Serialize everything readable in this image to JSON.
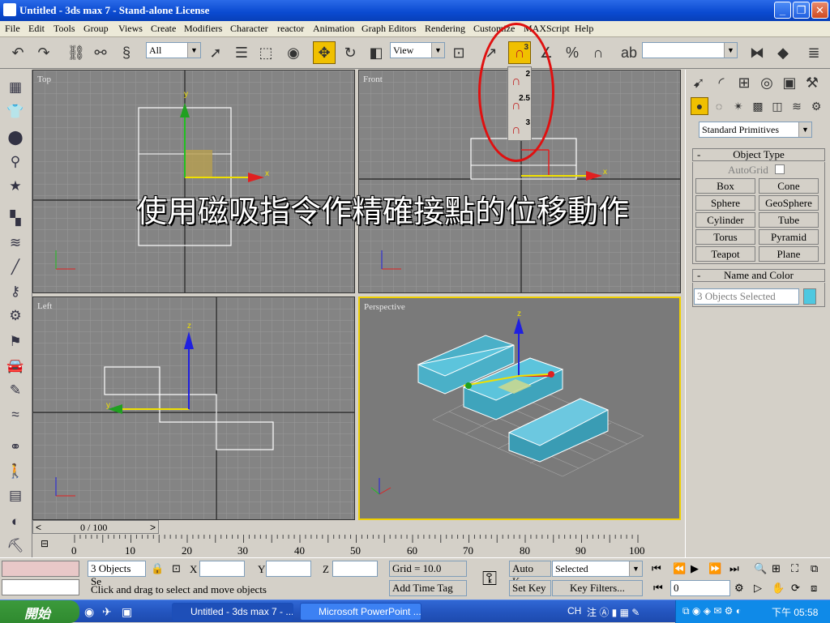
{
  "window": {
    "title": "Untitled - 3ds max 7  - Stand-alone License"
  },
  "menu": [
    "File",
    "Edit",
    "Tools",
    "Group",
    "Views",
    "Create",
    "Modifiers",
    "Character",
    "reactor",
    "Animation",
    "Graph Editors",
    "Rendering",
    "Customize",
    "MAXScript",
    "Help"
  ],
  "toolbar": {
    "selection_filter": "All",
    "ref_coord": "View",
    "named_selection": ""
  },
  "snap_flyout": {
    "items": [
      "2",
      "2.5",
      "3"
    ],
    "active": "3"
  },
  "viewports": {
    "top": "Top",
    "front": "Front",
    "left": "Left",
    "perspective": "Perspective"
  },
  "caption": "使用磁吸指令作精確接點的位移動作",
  "command_panel": {
    "category": "Standard Primitives",
    "object_type_header": "Object Type",
    "autogrid": "AutoGrid",
    "buttons": [
      "Box",
      "Cone",
      "Sphere",
      "GeoSphere",
      "Cylinder",
      "Tube",
      "Torus",
      "Pyramid",
      "Teapot",
      "Plane"
    ],
    "name_color_header": "Name and Color",
    "name_value": "3 Objects Selected",
    "swatch_color": "#4ec8e0",
    "minus": "-"
  },
  "timeline": {
    "frame": "0 / 100",
    "ticks": [
      "0",
      "10",
      "20",
      "30",
      "40",
      "50",
      "60",
      "70",
      "80",
      "90",
      "100"
    ]
  },
  "status": {
    "selection": "3 Objects Se",
    "x_label": "X",
    "y_label": "Y",
    "z_label": "Z",
    "grid": "Grid = 10.0",
    "prompt": "Click and drag to select and move objects",
    "add_time_tag": "Add Time Tag",
    "auto_key": "Auto Key",
    "set_key": "Set Key",
    "key_mode": "Selected",
    "key_filters": "Key Filters...",
    "frame_field": "0"
  },
  "taskbar": {
    "start": "開始",
    "tasks": [
      "Untitled - 3ds max 7 - ...",
      "Microsoft PowerPoint ..."
    ],
    "tray_lang": "CH",
    "clock": "下午 05:58"
  },
  "colors": {
    "selection_yellow": "#f0c000",
    "red_circle": "#e01010",
    "box_cyan": "#4ab0c8"
  }
}
